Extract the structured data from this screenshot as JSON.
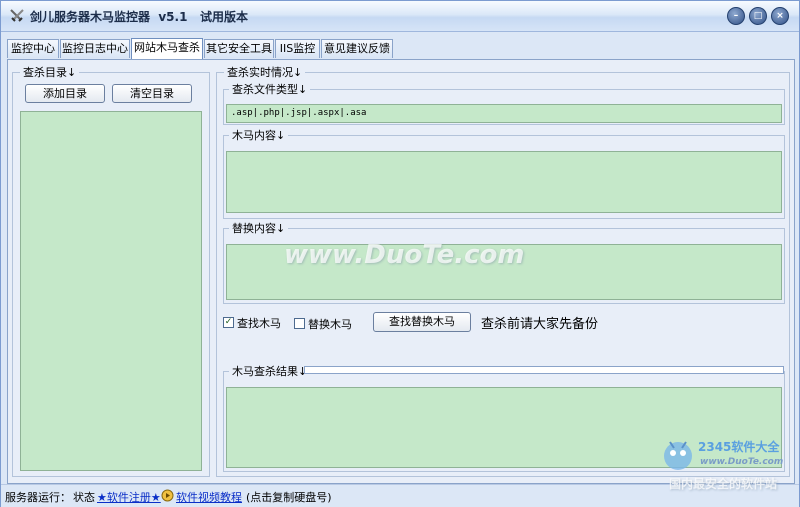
{
  "window": {
    "title": "剑儿服务器木马监控器  v5.1   试用版本",
    "controls": {
      "minimize": "–",
      "maximize": "□",
      "close": "×"
    }
  },
  "tabs": [
    {
      "label": "监控中心"
    },
    {
      "label": "监控日志中心"
    },
    {
      "label": "网站木马查杀"
    },
    {
      "label": "其它安全工具"
    },
    {
      "label": "IIS监控"
    },
    {
      "label": "意见建议反馈"
    }
  ],
  "active_tab": "网站木马查杀",
  "left_panel": {
    "legend": "查杀目录↓",
    "add_button": "添加目录",
    "clear_button": "清空目录"
  },
  "right_panel": {
    "legend": "查杀实时情况↓",
    "file_types": {
      "legend": "查杀文件类型↓",
      "value": ".asp|.php|.jsp|.aspx|.asa"
    },
    "trojan_content": {
      "legend": "木马内容↓"
    },
    "replace_content": {
      "legend": "替换内容↓"
    },
    "find_trojan": {
      "label": "查找木马",
      "checked": true
    },
    "replace_trojan": {
      "label": "替换木马",
      "checked": false
    },
    "find_replace_button": "查找替换木马",
    "backup_notice": "查杀前请大家先备份",
    "results": {
      "legend": "木马查杀结果↓"
    }
  },
  "statusbar": {
    "server_status_label": "服务器运行：",
    "status_label": "状态",
    "register_link": "★软件注册★",
    "video_tutorial_link": "软件视频教程",
    "hint": "(点击复制硬盘号)"
  },
  "watermark": {
    "center": "www.DuoTe.com",
    "logo_text": "2345软件大全",
    "logo_url": "www.DuoTe.com",
    "bottom_text": "国内最安全的软件站"
  },
  "colors": {
    "panel_green": "#c5e8c9",
    "link_blue": "#0a2ec7"
  }
}
